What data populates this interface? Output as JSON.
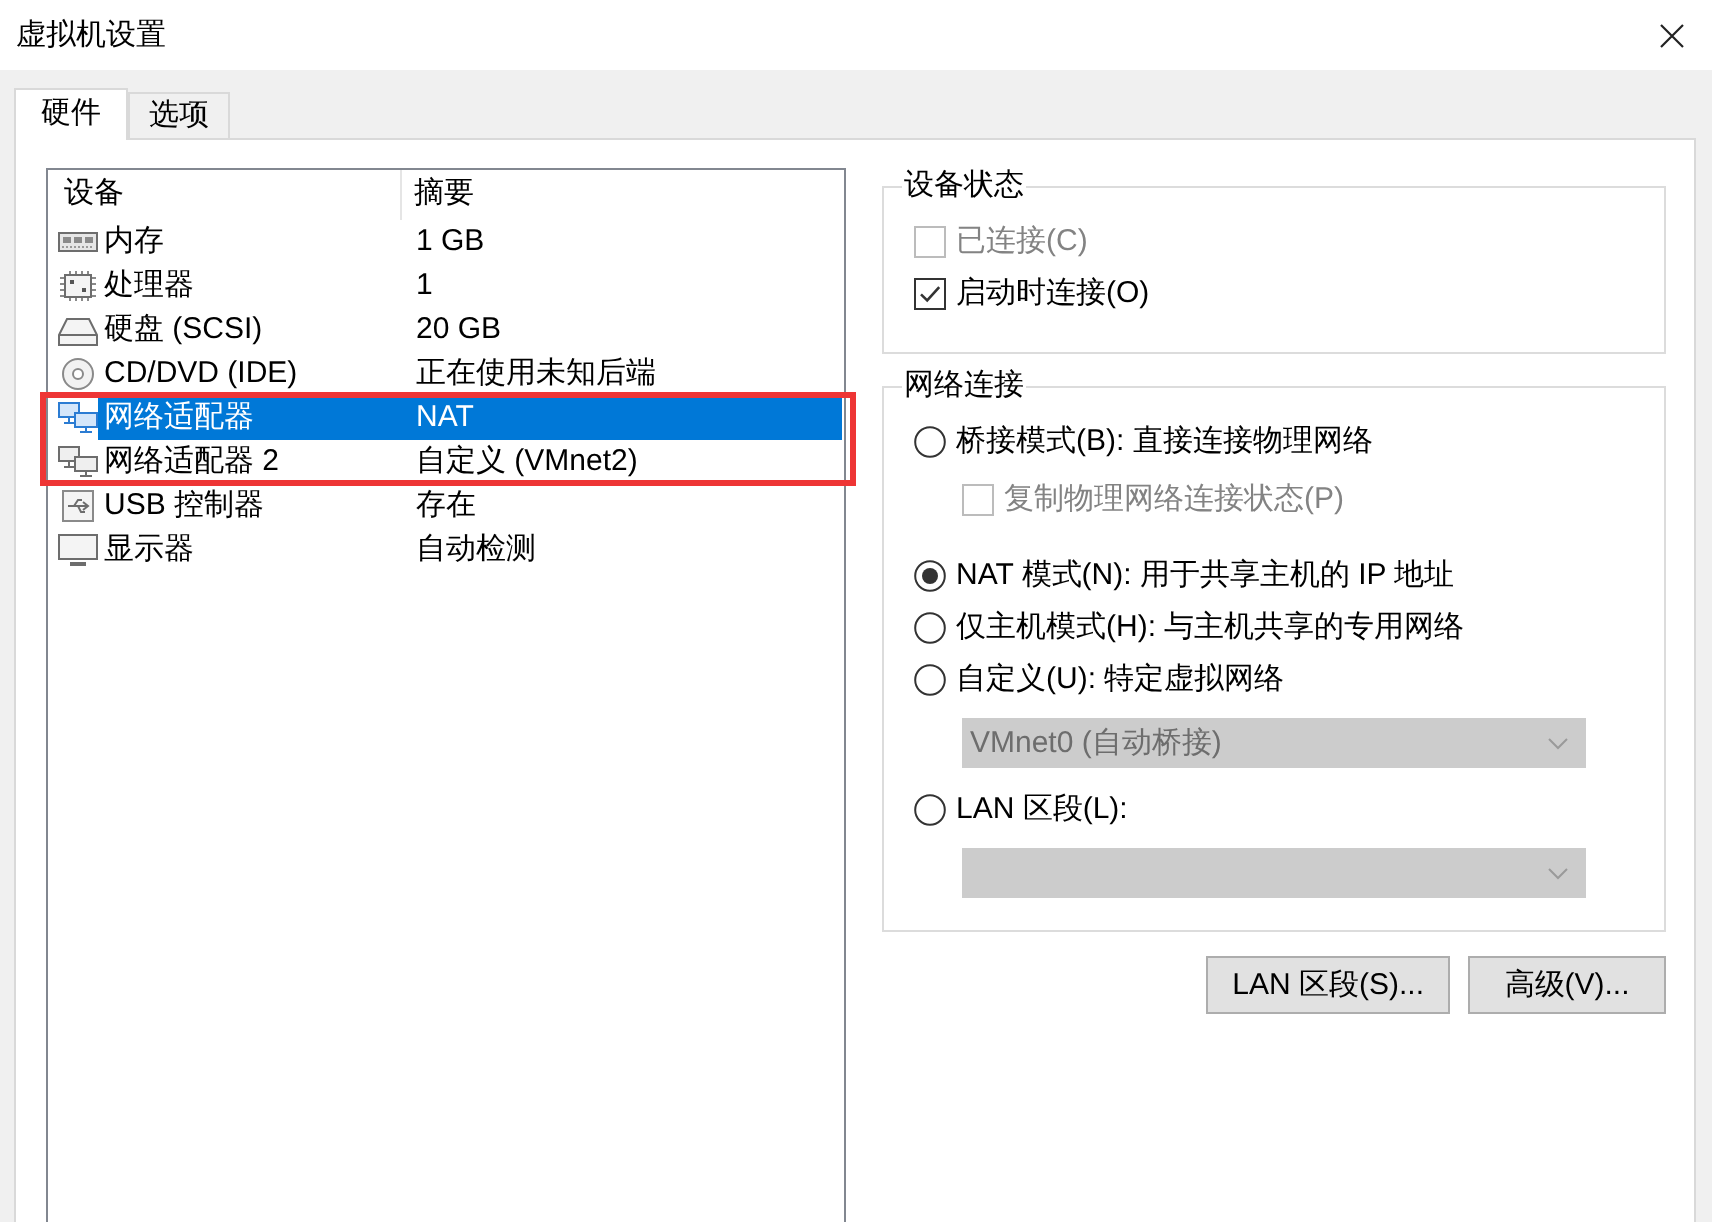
{
  "window": {
    "title": "虚拟机设置"
  },
  "tabs": [
    {
      "label": "硬件",
      "selected": true
    },
    {
      "label": "选项",
      "selected": false
    }
  ],
  "device_list": {
    "columns": [
      "设备",
      "摘要"
    ],
    "rows": [
      {
        "kind": "memory",
        "device": "内存",
        "summary": "1 GB",
        "selected": false,
        "annotated": false
      },
      {
        "kind": "processor",
        "device": "处理器",
        "summary": "1",
        "selected": false,
        "annotated": false
      },
      {
        "kind": "hard_disk",
        "device": "硬盘 (SCSI)",
        "summary": "20 GB",
        "selected": false,
        "annotated": false
      },
      {
        "kind": "cd_dvd",
        "device": "CD/DVD (IDE)",
        "summary": "正在使用未知后端",
        "selected": false,
        "annotated": false
      },
      {
        "kind": "network",
        "device": "网络适配器",
        "summary": "NAT",
        "selected": true,
        "annotated": true
      },
      {
        "kind": "network",
        "device": "网络适配器 2",
        "summary": "自定义 (VMnet2)",
        "selected": false,
        "annotated": true
      },
      {
        "kind": "usb",
        "device": "USB 控制器",
        "summary": "存在",
        "selected": false,
        "annotated": false
      },
      {
        "kind": "display",
        "device": "显示器",
        "summary": "自动检测",
        "selected": false,
        "annotated": false
      }
    ]
  },
  "device_status": {
    "title": "设备状态",
    "options": [
      {
        "label": "已连接(C)",
        "checked": false,
        "disabled": true
      },
      {
        "label": "启动时连接(O)",
        "checked": true,
        "disabled": false
      }
    ]
  },
  "network_connection": {
    "title": "网络连接",
    "options": [
      {
        "kind": "radio",
        "label": "桥接模式(B): 直接连接物理网络",
        "selected": false,
        "disabled": false
      },
      {
        "kind": "checkbox",
        "label": "复制物理网络连接状态(P)",
        "checked": false,
        "disabled": true
      },
      {
        "kind": "radio",
        "label": "NAT 模式(N): 用于共享主机的 IP 地址",
        "selected": true,
        "disabled": false
      },
      {
        "kind": "radio",
        "label": "仅主机模式(H): 与主机共享的专用网络",
        "selected": false,
        "disabled": false
      },
      {
        "kind": "radio",
        "label": "自定义(U): 特定虚拟网络",
        "selected": false,
        "disabled": false
      },
      {
        "kind": "dropdown",
        "value": "VMnet0 (自动桥接)",
        "disabled": true
      },
      {
        "kind": "radio",
        "label": "LAN 区段(L):",
        "selected": false,
        "disabled": false
      },
      {
        "kind": "dropdown",
        "disabled": true
      }
    ]
  },
  "buttons": [
    "LAN 区段(S)...",
    "高级(V)..."
  ]
}
